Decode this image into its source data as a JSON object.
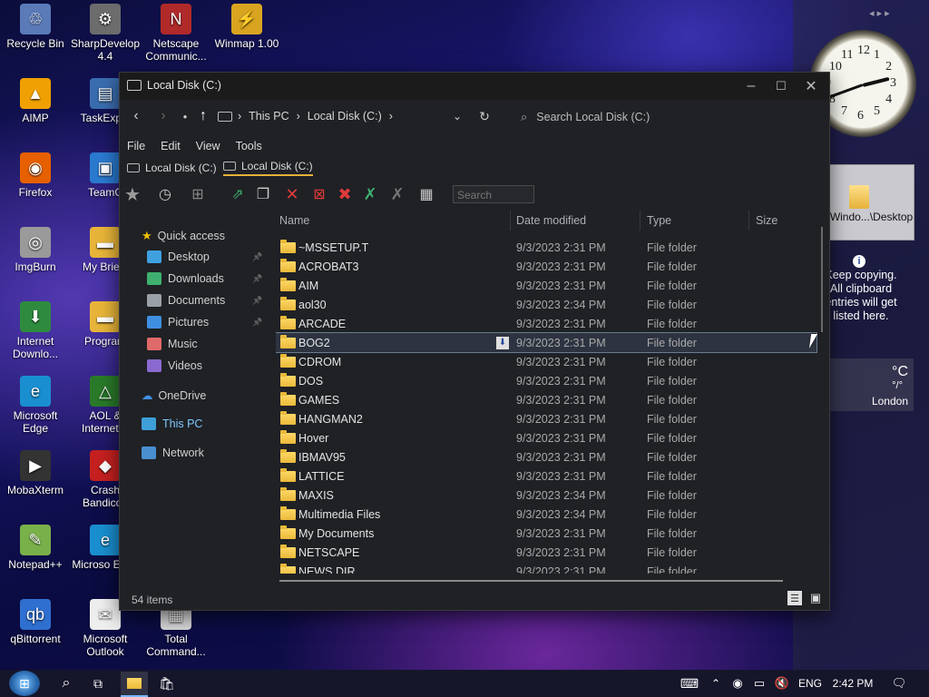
{
  "desktop_icons": [
    {
      "label": "Recycle Bin",
      "color": "#5a7ab8",
      "glyph": "♲"
    },
    {
      "label": "SharpDevelop 4.4",
      "color": "#6c6c6c",
      "glyph": "⚙"
    },
    {
      "label": "Netscape Communic...",
      "color": "#b02a2a",
      "glyph": "N"
    },
    {
      "label": "Winmap 1.00",
      "color": "#d9a520",
      "glyph": "⚡"
    },
    {
      "label": "AIMP",
      "color": "#f0a000",
      "glyph": "▲"
    },
    {
      "label": "TaskExplo",
      "color": "#3a6db0",
      "glyph": "▤"
    },
    {
      "label": "Firefox",
      "color": "#e66000",
      "glyph": "◉"
    },
    {
      "label": "TeamC",
      "color": "#2a7ad0",
      "glyph": "▣"
    },
    {
      "label": "ImgBurn",
      "color": "#9a9a9a",
      "glyph": "◎"
    },
    {
      "label": "My Briefc",
      "color": "#e8b53a",
      "glyph": "▬"
    },
    {
      "label": "Internet Downlo...",
      "color": "#2e8b3e",
      "glyph": "⬇"
    },
    {
      "label": "Program",
      "color": "#e8b53a",
      "glyph": "▬"
    },
    {
      "label": "Microsoft Edge",
      "color": "#1a8fd0",
      "glyph": "e"
    },
    {
      "label": "AOL & Internet E",
      "color": "#2a7a2a",
      "glyph": "△"
    },
    {
      "label": "MobaXterm",
      "color": "#333333",
      "glyph": "▶"
    },
    {
      "label": "Crash Bandicoo",
      "color": "#c62020",
      "glyph": "◆"
    },
    {
      "label": "Notepad++",
      "color": "#7ab04a",
      "glyph": "✎"
    },
    {
      "label": "Microso Edge",
      "color": "#1a8fd0",
      "glyph": "e"
    },
    {
      "label": "qBittorrent",
      "color": "#2f6fd0",
      "glyph": "qb"
    },
    {
      "label": "Microsoft Outlook",
      "color": "#eeeeee",
      "glyph": "✉"
    },
    {
      "label": "Total Command...",
      "color": "#d8d8d8",
      "glyph": "▦"
    }
  ],
  "window": {
    "title": "Local Disk (C:)",
    "breadcrumb": [
      "This PC",
      "Local Disk (C:)"
    ],
    "search_placeholder": "Search Local Disk (C:)",
    "menu": [
      "File",
      "Edit",
      "View",
      "Tools"
    ],
    "tabs": [
      "Local Disk (C:)",
      "Local Disk (C:)"
    ],
    "toolbar_search_placeholder": "Search",
    "columns": [
      "Name",
      "Date modified",
      "Type",
      "Size"
    ],
    "status": "54 items"
  },
  "sidebar": {
    "quick_access": "Quick access",
    "items": [
      {
        "label": "Desktop",
        "color": "#3fa0e0",
        "pinned": true
      },
      {
        "label": "Downloads",
        "color": "#3fb070",
        "pinned": true
      },
      {
        "label": "Documents",
        "color": "#9aa0a8",
        "pinned": true
      },
      {
        "label": "Pictures",
        "color": "#3f8fe0",
        "pinned": true
      },
      {
        "label": "Music",
        "color": "#e06a6a",
        "pinned": false
      },
      {
        "label": "Videos",
        "color": "#8a6ad0",
        "pinned": false
      }
    ],
    "onedrive": "OneDrive",
    "thispc": "This PC",
    "network": "Network"
  },
  "files": [
    {
      "name": "~MSSETUP.T",
      "date": "9/3/2023 2:31 PM",
      "type": "File folder"
    },
    {
      "name": "ACROBAT3",
      "date": "9/3/2023 2:31 PM",
      "type": "File folder"
    },
    {
      "name": "AIM",
      "date": "9/3/2023 2:31 PM",
      "type": "File folder"
    },
    {
      "name": "aol30",
      "date": "9/3/2023 2:34 PM",
      "type": "File folder"
    },
    {
      "name": "ARCADE",
      "date": "9/3/2023 2:31 PM",
      "type": "File folder"
    },
    {
      "name": "BOG2",
      "date": "9/3/2023 2:31 PM",
      "type": "File folder",
      "selected": true
    },
    {
      "name": "CDROM",
      "date": "9/3/2023 2:31 PM",
      "type": "File folder"
    },
    {
      "name": "DOS",
      "date": "9/3/2023 2:31 PM",
      "type": "File folder"
    },
    {
      "name": "GAMES",
      "date": "9/3/2023 2:31 PM",
      "type": "File folder"
    },
    {
      "name": "HANGMAN2",
      "date": "9/3/2023 2:31 PM",
      "type": "File folder"
    },
    {
      "name": "Hover",
      "date": "9/3/2023 2:31 PM",
      "type": "File folder"
    },
    {
      "name": "IBMAV95",
      "date": "9/3/2023 2:31 PM",
      "type": "File folder"
    },
    {
      "name": "LATTICE",
      "date": "9/3/2023 2:31 PM",
      "type": "File folder"
    },
    {
      "name": "MAXIS",
      "date": "9/3/2023 2:34 PM",
      "type": "File folder"
    },
    {
      "name": "Multimedia Files",
      "date": "9/3/2023 2:34 PM",
      "type": "File folder"
    },
    {
      "name": "My Documents",
      "date": "9/3/2023 2:31 PM",
      "type": "File folder"
    },
    {
      "name": "NETSCAPE",
      "date": "9/3/2023 2:31 PM",
      "type": "File folder"
    },
    {
      "name": "NEWS.DIR",
      "date": "9/3/2023 2:31 PM",
      "type": "File folder"
    }
  ],
  "right_panel": {
    "clip_label": "Windo...\\Desktop",
    "clip_hint": "Keep copying. All clipboard entries will get listed here.",
    "weather_unit": "°C",
    "weather_sub": "°/°",
    "weather_city": "London",
    "clock_numbers": [
      "12",
      "1",
      "2",
      "3",
      "4",
      "5",
      "6",
      "7",
      "8",
      "9",
      "10",
      "11"
    ]
  },
  "taskbar": {
    "lang": "ENG",
    "time": "2:42 PM"
  }
}
